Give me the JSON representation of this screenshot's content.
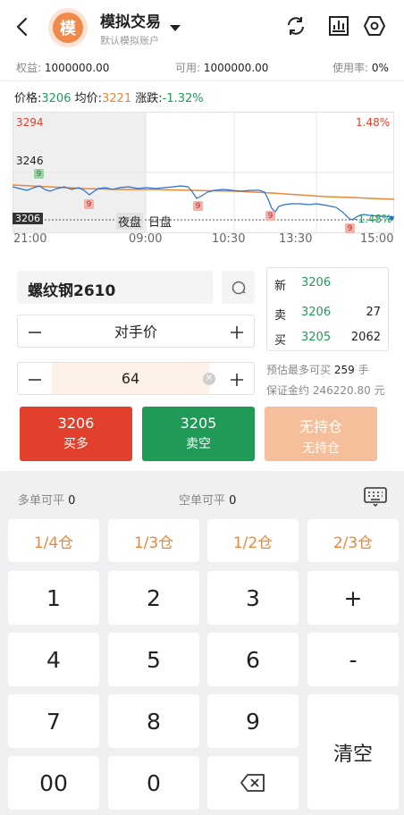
{
  "header": {
    "avatar_char": "模",
    "title": "模拟交易",
    "subtitle": "默认模拟账户"
  },
  "account": {
    "equity_label": "权益:",
    "equity_value": "1000000.00",
    "available_label": "可用:",
    "available_value": "1000000.00",
    "usage_label": "使用率:",
    "usage_value": "0%"
  },
  "price_row": {
    "price_label": "价格:",
    "price_value": "3206",
    "avg_label": "均价:",
    "avg_value": "3221",
    "change_label": "涨跌:",
    "change_value": "-1.32%"
  },
  "chart": {
    "high_price": "3294",
    "high_pct": "1.48%",
    "mid_price": "3246",
    "low_price": "3206",
    "low_pct": "-1.48%",
    "night_label": "夜盘",
    "day_label": "日盘",
    "marker_label": "9",
    "times": [
      "21:00",
      "09:00",
      "10:30",
      "13:30",
      "15:00"
    ],
    "colors": {
      "price_line": "#2a6fd1",
      "avg_line": "#e8883a"
    }
  },
  "order": {
    "contract": "螺纹钢2610",
    "price_type": "对手价",
    "quantity": "64"
  },
  "quote": {
    "latest_label": "新",
    "latest_price": "3206",
    "ask_label": "卖",
    "ask_price": "3206",
    "ask_volume": "27",
    "bid_label": "买",
    "bid_price": "3205",
    "bid_volume": "2062"
  },
  "estimate": {
    "max_label": "预估最多可买",
    "max_value": "259",
    "max_unit": "手",
    "margin_label": "保证金约",
    "margin_value": "246220.80",
    "margin_unit": "元"
  },
  "actions": {
    "buy_price": "3206",
    "buy_label": "买多",
    "sell_price": "3205",
    "sell_label": "卖空",
    "close_label1": "无持仓",
    "close_label2": "无持仓",
    "colors": {
      "buy": "#e0402c",
      "sell": "#1f9a57",
      "close": "#f6bf9b"
    }
  },
  "keypad": {
    "long_close_label": "多单可平",
    "long_close_value": "0",
    "short_close_label": "空单可平",
    "short_close_value": "0",
    "position_keys": [
      "1/4仓",
      "1/3仓",
      "1/2仓",
      "2/3仓"
    ],
    "digit_keys": [
      "1",
      "2",
      "3",
      "4",
      "5",
      "6",
      "7",
      "8",
      "9",
      "00",
      "0"
    ],
    "plus_label": "+",
    "minus_label": "-",
    "clear_label": "清空"
  }
}
